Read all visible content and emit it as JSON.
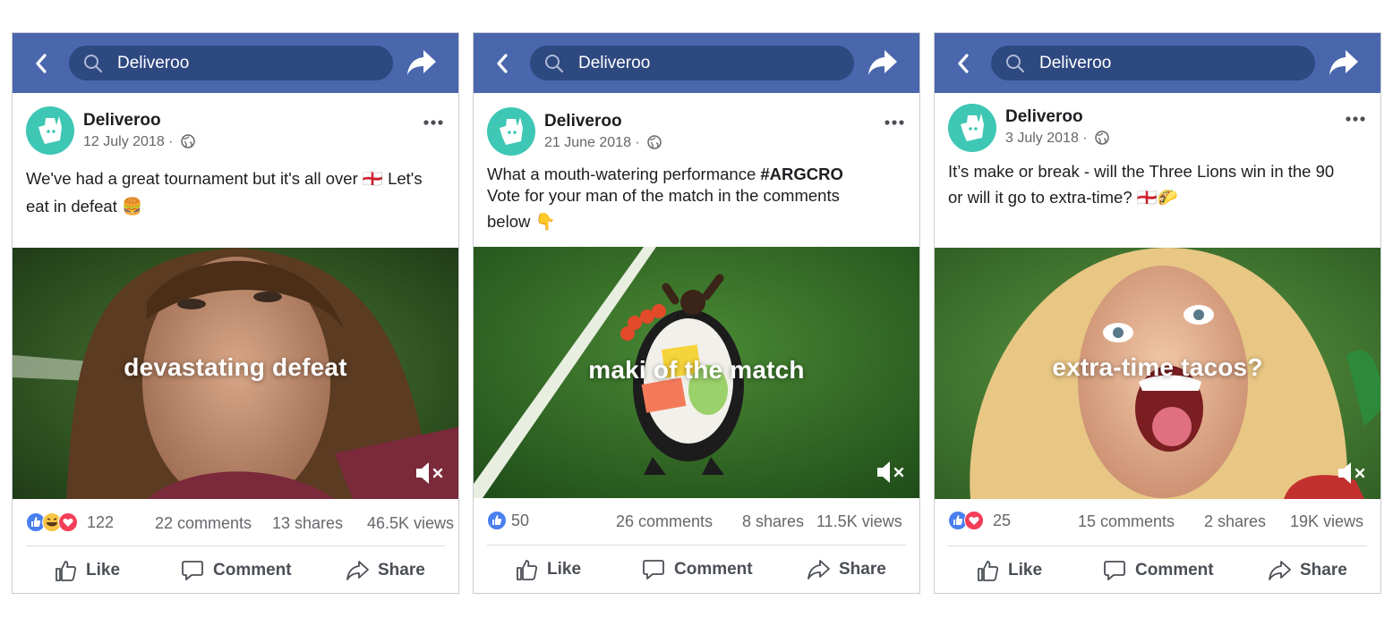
{
  "posts": [
    {
      "search_text": "Deliveroo",
      "page_name": "Deliveroo",
      "date": "12 July 2018",
      "text_lines": [
        "We've had a great tournament but it's all over 🏴󠁧󠁢󠁥󠁮󠁧󠁿 Let's",
        "eat in defeat 🍔"
      ],
      "video_caption": "devastating defeat",
      "reaction_count": "122",
      "reaction_types": [
        "like-icon",
        "haha-icon",
        "love-icon"
      ],
      "comments": "22 comments",
      "shares": "13 shares",
      "views": "46.5K views",
      "like_label": "Like",
      "comment_label": "Comment",
      "share_label": "Share"
    },
    {
      "search_text": "Deliveroo",
      "page_name": "Deliveroo",
      "date": "21 June 2018",
      "text_line1_prefix": "What a mouth-watering performance ",
      "text_line1_hashtag": "#ARGCRO",
      "text_line2": "Vote for your man of the match in the comments",
      "text_line3": "below 👇",
      "video_caption": "maki of the match",
      "reaction_count": "50",
      "reaction_types": [
        "like-icon"
      ],
      "comments": "26 comments",
      "shares": "8 shares",
      "views": "11.5K views",
      "like_label": "Like",
      "comment_label": "Comment",
      "share_label": "Share"
    },
    {
      "search_text": "Deliveroo",
      "page_name": "Deliveroo",
      "date": "3 July 2018",
      "text_lines": [
        "It’s make or break - will the Three Lions win in the 90",
        "or will it go to extra-time? 🏴󠁧󠁢󠁥󠁮󠁧󠁿🌮"
      ],
      "video_caption": "extra-time tacos?",
      "reaction_count": "25",
      "reaction_types": [
        "like-icon",
        "love-icon"
      ],
      "comments": "15 comments",
      "shares": "2 shares",
      "views": "19K views",
      "like_label": "Like",
      "comment_label": "Comment",
      "share_label": "Share"
    }
  ],
  "colors": {
    "topbar": "#4a66ad",
    "search_bg": "#2e4880",
    "avatar_bg": "#3ec7b4",
    "like_blue": "#4a7ff0",
    "love_red": "#f33e58",
    "haha_yellow": "#f7c544"
  }
}
